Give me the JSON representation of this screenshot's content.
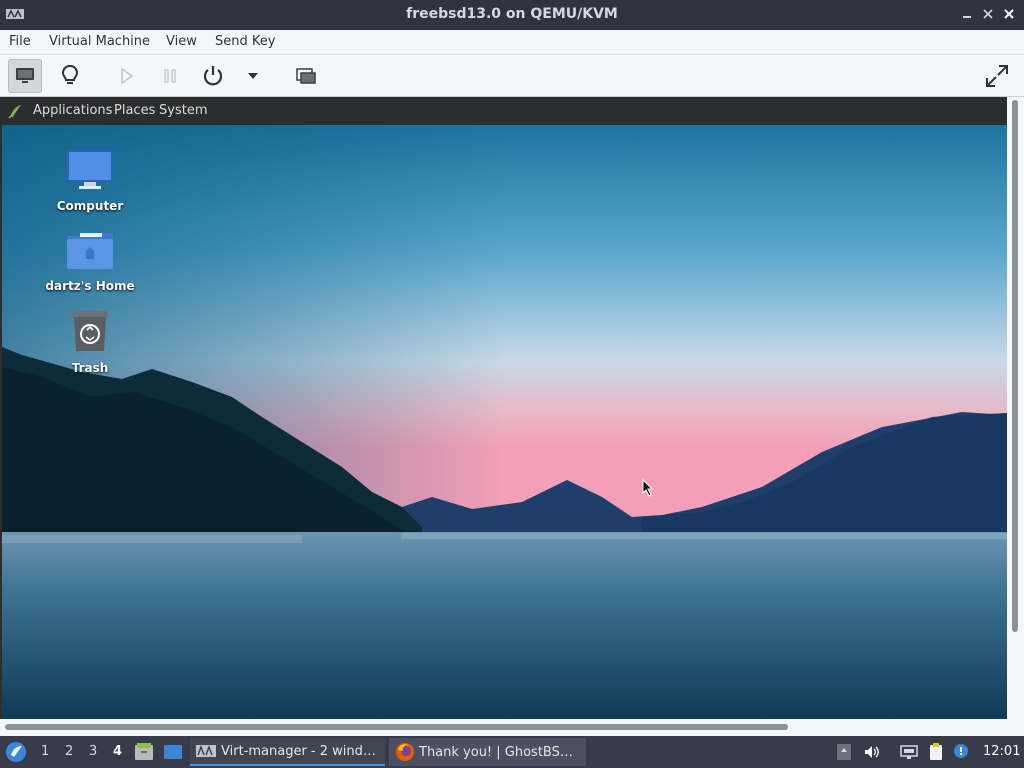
{
  "window": {
    "title": "freebsd13.0 on QEMU/KVM"
  },
  "menubar": {
    "items": [
      "File",
      "Virtual Machine",
      "View",
      "Send Key"
    ]
  },
  "toolbar": {
    "buttons": [
      {
        "name": "console-view-button",
        "icon": "monitor-icon"
      },
      {
        "name": "details-view-button",
        "icon": "lightbulb-icon"
      },
      {
        "name": "run-button",
        "icon": "play-icon"
      },
      {
        "name": "pause-button",
        "icon": "pause-icon"
      },
      {
        "name": "shutdown-button",
        "icon": "power-icon"
      },
      {
        "name": "shutdown-menu-button",
        "icon": "chevron-down-icon"
      },
      {
        "name": "snapshots-button",
        "icon": "snapshots-icon"
      },
      {
        "name": "fullscreen-button",
        "icon": "fullscreen-icon"
      }
    ]
  },
  "guest": {
    "panel": {
      "menus": [
        "Applications",
        "Places",
        "System"
      ]
    },
    "desktop_icons": [
      {
        "label": "Computer",
        "icon": "computer-icon"
      },
      {
        "label": "dartz's Home",
        "icon": "home-folder-icon"
      },
      {
        "label": "Trash",
        "icon": "trash-icon"
      }
    ]
  },
  "taskbar": {
    "workspaces": [
      "1",
      "2",
      "3",
      "4"
    ],
    "current_workspace": "4",
    "tasks": [
      {
        "label": "Virt-manager - 2 wind…",
        "icon": "virt-manager-icon",
        "active": true
      },
      {
        "label": "Thank you! | GhostBS…",
        "icon": "firefox-icon",
        "active": false
      }
    ],
    "clock": "12:01"
  },
  "colors": {
    "accent": "#5294e2",
    "taskbar_bg": "#383c4a",
    "titlebar_bg": "#2f343f"
  }
}
